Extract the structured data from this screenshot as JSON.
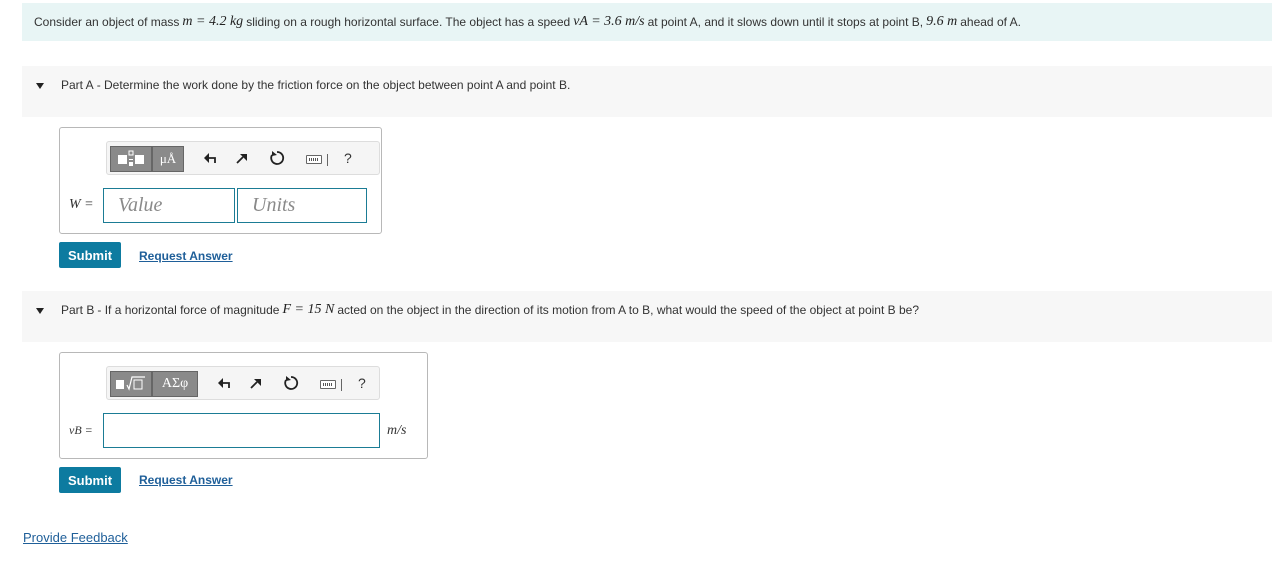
{
  "intro": {
    "t1": "Consider an object of mass",
    "m_eq": "m = 4.2 kg",
    "t2": "sliding on a rough horizontal surface. The object has a speed",
    "v_eq": "vA = 3.6 m/s",
    "t3": "at point A, and it slows down until it stops at point B,",
    "d_eq": "9.6 m",
    "t4": "ahead of A."
  },
  "partA": {
    "title": "Part A",
    "text": "- Determine the work done by the friction force on the object between point A and point B.",
    "label": "W =",
    "value_placeholder": "Value",
    "units_placeholder": "Units",
    "toolbar_btn2": "μÅ",
    "help": "?",
    "submit": "Submit",
    "request": "Request Answer"
  },
  "partB": {
    "title": "Part B",
    "text1": "- If a horizontal force of magnitude",
    "f_eq": "F = 15 N",
    "text2": "acted on the object in the direction of its motion from A to B, what would the speed of the object at point B be?",
    "label": "vB =",
    "unit": "m/s",
    "toolbar_btn2": "ΑΣφ",
    "help": "?",
    "submit": "Submit",
    "request": "Request Answer"
  },
  "feedback": "Provide Feedback",
  "colors": {
    "accent": "#0d7ba0",
    "intro_bg": "#e8f5f5",
    "header_bg": "#f7f7f7",
    "link": "#1f5f99"
  }
}
